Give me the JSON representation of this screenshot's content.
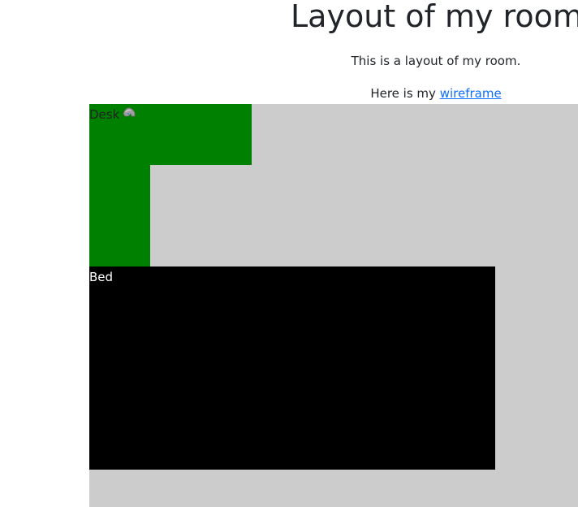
{
  "header": {
    "title": "Layout of my room"
  },
  "intro": {
    "text": "This is a layout of my room."
  },
  "wireframe_line": {
    "prefix": "Here is my ",
    "link_label": "wireframe"
  },
  "room": {
    "desk": {
      "label": "Desk",
      "color": "#008000",
      "image_icon": "broken-image-icon"
    },
    "bed": {
      "label": "Bed",
      "color": "#000000"
    },
    "floor_color": "#cccccc"
  }
}
